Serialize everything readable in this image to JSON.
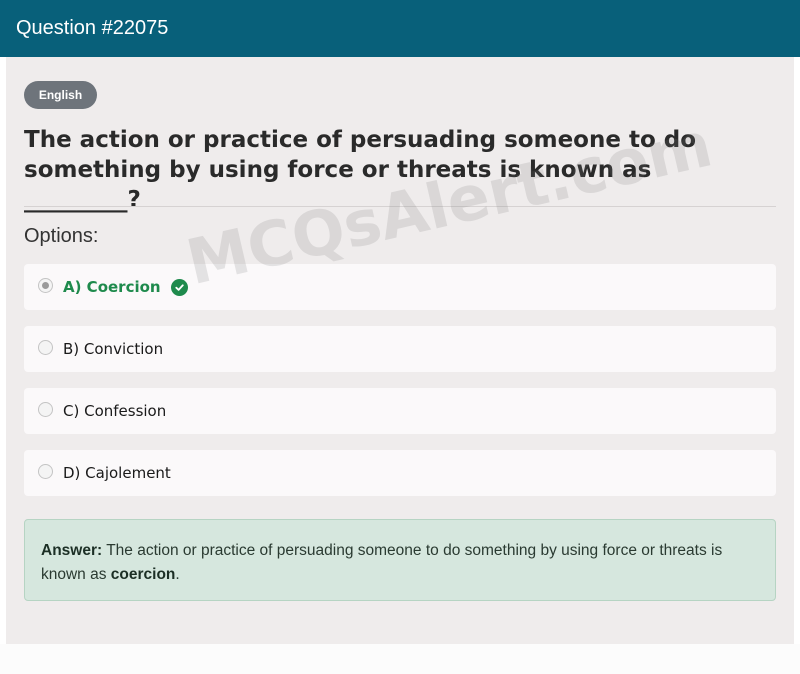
{
  "header": {
    "title": "Question #22075"
  },
  "language_badge": "English",
  "question": {
    "text": "The action or practice of persuading someone to do something by using force or threats is known as _________?"
  },
  "options_label": "Options:",
  "options": [
    {
      "label": "A) Coercion",
      "selected": true,
      "correct": true
    },
    {
      "label": "B) Conviction",
      "selected": false,
      "correct": false
    },
    {
      "label": "C) Confession",
      "selected": false,
      "correct": false
    },
    {
      "label": "D) Cajolement",
      "selected": false,
      "correct": false
    }
  ],
  "answer": {
    "prefix": "Answer:",
    "text": "The action or practice of persuading someone to do something by using force or threats is known as",
    "highlight": "coercion",
    "suffix": "."
  },
  "watermark": "MCQsAlert.com",
  "colors": {
    "header_bg": "#08607a",
    "card_bg": "#efecec",
    "correct_green": "#1e8a4c",
    "answer_bg": "#d6e7de"
  }
}
